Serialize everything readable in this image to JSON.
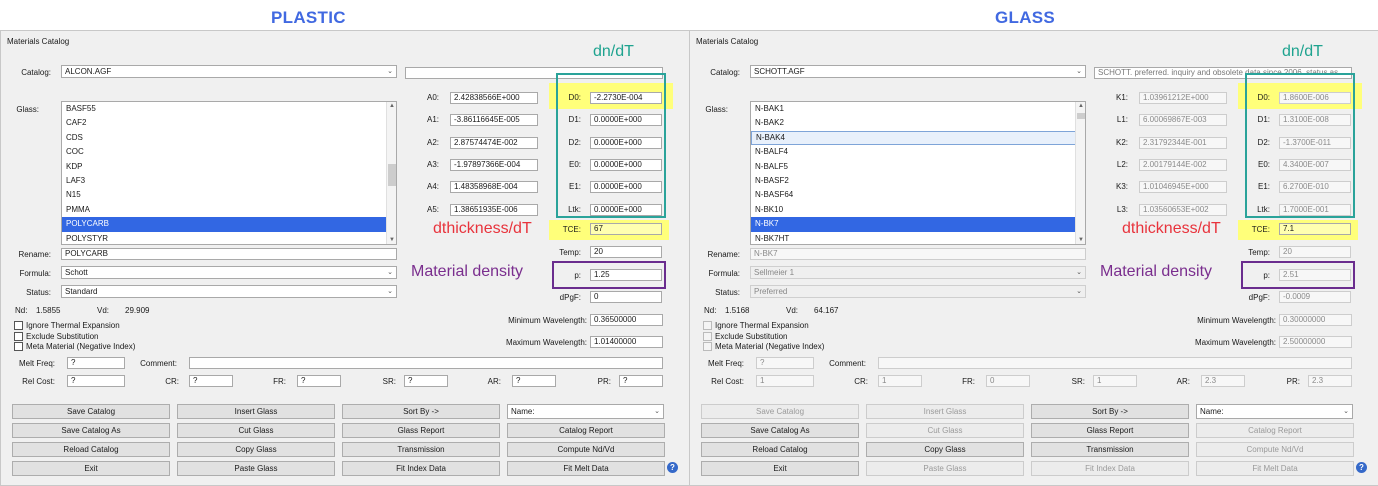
{
  "headers": {
    "left": "PLASTIC",
    "right": "GLASS"
  },
  "colors": {
    "header": "#4169e1",
    "dndt": "#1ea38f",
    "dthickness": "#e8333c",
    "density": "#7a2e8e",
    "highlight": "#ffff7a",
    "selection": "#3267e3"
  },
  "annotations": {
    "dndt": "dn/dT",
    "dthickness": "dthickness/dT",
    "density": "Material density"
  },
  "panels": [
    {
      "window_title": "Materials Catalog",
      "catalog_label": "Catalog:",
      "catalog_value": "ALCON.AGF",
      "description": "",
      "glass_label": "Glass:",
      "glass_list": [
        "BASF55",
        "CAF2",
        "CDS",
        "COC",
        "KDP",
        "LAF3",
        "N15",
        "PMMA",
        "POLYCARB",
        "POLYSTYR"
      ],
      "selected_index": 8,
      "focused_index": -1,
      "coeffs": [
        {
          "label": "A0:",
          "value": "2.42838566E+000"
        },
        {
          "label": "A1:",
          "value": "-3.86116645E-005"
        },
        {
          "label": "A2:",
          "value": "2.87574474E-002"
        },
        {
          "label": "A3:",
          "value": "-1.97897366E-004"
        },
        {
          "label": "A4:",
          "value": "1.48358968E-004"
        },
        {
          "label": "A5:",
          "value": "1.38651935E-006"
        }
      ],
      "thermal": [
        {
          "label": "D0:",
          "value": "-2.2730E-004"
        },
        {
          "label": "D1:",
          "value": "0.0000E+000"
        },
        {
          "label": "D2:",
          "value": "0.0000E+000"
        },
        {
          "label": "E0:",
          "value": "0.0000E+000"
        },
        {
          "label": "E1:",
          "value": "0.0000E+000"
        },
        {
          "label": "Ltk:",
          "value": "0.0000E+000"
        }
      ],
      "tce_label": "TCE:",
      "tce_value": "67",
      "temp_label": "Temp:",
      "temp_value": "20",
      "density_label": "p:",
      "density_value": "1.25",
      "dpgf_label": "dPgF:",
      "dpgf_value": "0",
      "rename_label": "Rename:",
      "rename_value": "POLYCARB",
      "formula_label": "Formula:",
      "formula_value": "Schott",
      "status_label": "Status:",
      "status_value": "Standard",
      "nd_label": "Nd:",
      "nd_value": "1.5855",
      "vd_label": "Vd:",
      "vd_value": "29.909",
      "checkboxes": [
        "Ignore Thermal Expansion",
        "Exclude Substitution",
        "Meta Material (Negative Index)"
      ],
      "min_wl_label": "Minimum Wavelength:",
      "min_wl_value": "0.36500000",
      "max_wl_label": "Maximum Wavelength:",
      "max_wl_value": "1.01400000",
      "melt_label": "Melt Freq:",
      "melt_value": "?",
      "comment_label": "Comment:",
      "comment_value": "",
      "relcost_label": "Rel Cost:",
      "relcost_value": "?",
      "cr_label": "CR:",
      "cr_value": "?",
      "fr_label": "FR:",
      "fr_value": "?",
      "sr_label": "SR:",
      "sr_value": "?",
      "ar_label": "AR:",
      "ar_value": "?",
      "pr_label": "PR:",
      "pr_value": "?",
      "sort_value": "Name:",
      "buttons": [
        [
          "Save Catalog",
          "Insert Glass",
          "Sort By ->"
        ],
        [
          "Save Catalog As",
          "Cut Glass",
          "Glass Report",
          "Catalog Report"
        ],
        [
          "Reload Catalog",
          "Copy Glass",
          "Transmission",
          "Compute Nd/Vd"
        ],
        [
          "Exit",
          "Paste Glass",
          "Fit Index Data",
          "Fit Melt Data"
        ]
      ],
      "help": "?"
    },
    {
      "window_title": "Materials Catalog",
      "catalog_label": "Catalog:",
      "catalog_value": "SCHOTT.AGF",
      "description": "SCHOTT. preferred. inquiry and obsolete data since 2006. status as",
      "glass_label": "Glass:",
      "glass_list": [
        "N-BAK1",
        "N-BAK2",
        "N-BAK4",
        "N-BALF4",
        "N-BALF5",
        "N-BASF2",
        "N-BASF64",
        "N-BK10",
        "N-BK7",
        "N-BK7HT"
      ],
      "selected_index": 8,
      "focused_index": 2,
      "coeffs": [
        {
          "label": "K1:",
          "value": "1.03961212E+000"
        },
        {
          "label": "L1:",
          "value": "6.00069867E-003"
        },
        {
          "label": "K2:",
          "value": "2.31792344E-001"
        },
        {
          "label": "L2:",
          "value": "2.00179144E-002"
        },
        {
          "label": "K3:",
          "value": "1.01046945E+000"
        },
        {
          "label": "L3:",
          "value": "1.03560653E+002"
        }
      ],
      "thermal": [
        {
          "label": "D0:",
          "value": "1.8600E-006"
        },
        {
          "label": "D1:",
          "value": "1.3100E-008"
        },
        {
          "label": "D2:",
          "value": "-1.3700E-011"
        },
        {
          "label": "E0:",
          "value": "4.3400E-007"
        },
        {
          "label": "E1:",
          "value": "6.2700E-010"
        },
        {
          "label": "Ltk:",
          "value": "1.7000E-001"
        }
      ],
      "tce_label": "TCE:",
      "tce_value": "7.1",
      "temp_label": "Temp:",
      "temp_value": "20",
      "density_label": "p:",
      "density_value": "2.51",
      "dpgf_label": "dPgF:",
      "dpgf_value": "-0.0009",
      "rename_label": "Rename:",
      "rename_value": "N-BK7",
      "formula_label": "Formula:",
      "formula_value": "Sellmeier 1",
      "status_label": "Status:",
      "status_value": "Preferred",
      "nd_label": "Nd:",
      "nd_value": "1.5168",
      "vd_label": "Vd:",
      "vd_value": "64.167",
      "checkboxes": [
        "Ignore Thermal Expansion",
        "Exclude Substitution",
        "Meta Material (Negative Index)"
      ],
      "min_wl_label": "Minimum Wavelength:",
      "min_wl_value": "0.30000000",
      "max_wl_label": "Maximum Wavelength:",
      "max_wl_value": "2.50000000",
      "melt_label": "Melt Freq:",
      "melt_value": "?",
      "comment_label": "Comment:",
      "comment_value": "",
      "relcost_label": "Rel Cost:",
      "relcost_value": "1",
      "cr_label": "CR:",
      "cr_value": "1",
      "fr_label": "FR:",
      "fr_value": "0",
      "sr_label": "SR:",
      "sr_value": "1",
      "ar_label": "AR:",
      "ar_value": "2.3",
      "pr_label": "PR:",
      "pr_value": "2.3",
      "sort_value": "Name:",
      "buttons": [
        [
          "Save Catalog",
          "Insert Glass",
          "Sort By ->"
        ],
        [
          "Save Catalog As",
          "Cut Glass",
          "Glass Report",
          "Catalog Report"
        ],
        [
          "Reload Catalog",
          "Copy Glass",
          "Transmission",
          "Compute Nd/Vd"
        ],
        [
          "Exit",
          "Paste Glass",
          "Fit Index Data",
          "Fit Melt Data"
        ]
      ],
      "help": "?"
    }
  ]
}
